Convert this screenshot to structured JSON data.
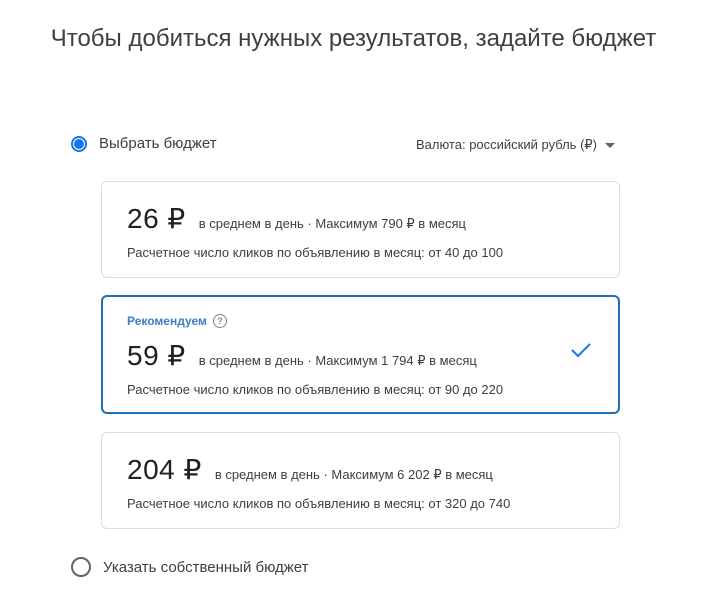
{
  "title": "Чтобы добиться нужных результатов, задайте бюджет",
  "choose_budget": {
    "label": "Выбрать бюджет",
    "selected": true
  },
  "currency": {
    "label": "Валюта: российский рубль (₽)",
    "icon": "dropdown-caret-icon"
  },
  "options": [
    {
      "price": "26 ₽",
      "per_day": "в среднем в день · Максимум 790 ₽ в месяц",
      "clicks": "Расчетное число кликов по объявлению в месяц: от 40 до 100",
      "selected": false
    },
    {
      "badge": "Рекомендуем",
      "help_icon": "help-circle-icon",
      "price": "59 ₽",
      "per_day": "в среднем в день · Максимум 1 794 ₽ в месяц",
      "clicks": "Расчетное число кликов по объявлению в месяц: от 90 до 220",
      "selected": true,
      "check_icon": "checkmark-icon"
    },
    {
      "price": "204 ₽",
      "per_day": "в среднем в день · Максимум 6 202 ₽ в месяц",
      "clicks": "Расчетное число кликов по объявлению в месяц: от 320 до 740",
      "selected": false
    }
  ],
  "custom_budget": {
    "label": "Указать собственный бюджет",
    "selected": false
  },
  "colors": {
    "accent": "#1a73e8",
    "text": "#202124",
    "border": "#dadce0"
  }
}
